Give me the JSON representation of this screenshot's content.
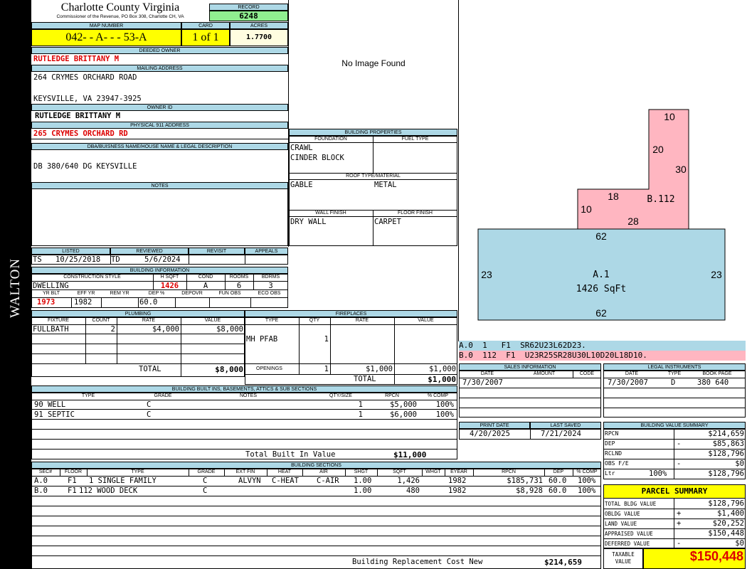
{
  "sidebar": {
    "district": "WALTON"
  },
  "header": {
    "county": "Charlotte County Virginia",
    "commissioner": "Commissioner of the Revenue, PO Box 308, Charlotte CH, VA",
    "record_label": "RECORD",
    "record": "6248",
    "map_number_label": "MAP NUMBER",
    "map_number": "042- - A- - - 53-A",
    "card_label": "CARD",
    "card": "1 of 1",
    "acres_label": "ACRES",
    "acres": "1.7700"
  },
  "owner": {
    "deeded_owner_label": "DEEDED OWNER",
    "deeded_owner": "RUTLEDGE BRITTANY M",
    "mailing_address_label": "MAILING ADDRESS",
    "address_line1": "264 CRYMES ORCHARD ROAD",
    "address_line2": "KEYSVILLE, VA 23947-3925",
    "owner_id_label": "OWNER ID",
    "owner_id": "RUTLEDGE BRITTANY M",
    "physical_address_label": "PHYSICAL 911 ADDRESS",
    "physical_address": "265 CRYMES ORCHARD RD",
    "dba_label": "DBA/BUISNESS NAME/HOUSE NAME & LEGAL DESCRIPTION",
    "legal_description": "DB 380/640 DG KEYSVILLE",
    "notes_label": "NOTES"
  },
  "image": {
    "placeholder": "No Image Found"
  },
  "building_properties": {
    "title": "BUILDING PROPERTIES",
    "foundation_label": "FOUNDATION",
    "fuel_type_label": "FUEL TYPE",
    "foundation1": "CRAWL",
    "foundation2": "CINDER BLOCK",
    "roof_label": "ROOF TYPE/MATERIAL",
    "roof_type": "GABLE",
    "roof_material": "METAL",
    "wall_finish_label": "WALL FINISH",
    "floor_finish_label": "FLOOR FINISH",
    "wall_finish": "DRY WALL",
    "floor_finish": "CARPET"
  },
  "review": {
    "listed_label": "LISTED",
    "reviewed_label": "REVIEWED",
    "revisit_label": "REVISIT",
    "appeals_label": "APPEALS",
    "listed_by": "TS",
    "listed_date": "10/25/2018",
    "reviewed_by": "TD",
    "reviewed_date": "5/6/2024"
  },
  "building_info": {
    "title": "BUILDING INFORMATION",
    "construction_style_label": "CONSTRUCTION STYLE",
    "hsqft_label": "H SQFT",
    "cond_label": "COND",
    "rooms_label": "ROOMS",
    "bdrms_label": "BDRMS",
    "construction_style": "DWELLING",
    "hsqft": "1426",
    "cond": "A",
    "rooms": "6",
    "bdrms": "3",
    "yr_blt_label": "YR BLT",
    "eff_yr_label": "EFF YR",
    "rem_yr_label": "REM YR",
    "dep_label": "DEP %",
    "depovr_label": "DEPOVR",
    "fun_obs_label": "FUN OBS",
    "eco_obs_label": "ECO OBS",
    "yr_blt": "1973",
    "eff_yr": "1982",
    "dep": "60.0"
  },
  "plumbing": {
    "title": "PLUMBING",
    "fixture_label": "FIXTURE",
    "count_label": "COUNT",
    "rate_label": "RATE",
    "value_label": "VALUE",
    "fixture": "FULLBATH",
    "count": "2",
    "rate": "$4,000",
    "value": "$8,000",
    "total_label": "TOTAL",
    "total": "$8,000"
  },
  "fireplaces": {
    "title": "FIREPLACES",
    "type_label": "TYPE",
    "qty_label": "QTY",
    "rate_label": "RATE",
    "value_label": "VALUE",
    "type": "MH PFAB",
    "qty": "1",
    "openings_label": "OPENINGS",
    "openings": "1",
    "openings_rate": "$1,000",
    "openings_value": "$1,000",
    "total_label": "TOTAL",
    "total": "$1,000"
  },
  "sketch": {
    "a_label": "A.1",
    "a_sqft": "1426 SqFt",
    "a_top": "62",
    "a_bottom": "62",
    "a_left": "23",
    "a_right": "23",
    "b_label": "B.112",
    "b_10_top": "10",
    "b_20": "20",
    "b_30": "30",
    "b_18": "18",
    "b_10_left": "10",
    "b_28": "28",
    "fill_a": "#add8e6",
    "fill_b": "#ffb6c1"
  },
  "traverse": {
    "a_line": "A.0  1   F1  SR62U23L62D23.",
    "b_line": "B.0  112  F1  U23R25SR28U30L10D20L18D10."
  },
  "sales": {
    "title": "SALES INFORMATION",
    "date_label": "DATE",
    "amount_label": "AMOUNT",
    "code_label": "CODE",
    "date": "7/30/2007"
  },
  "legal": {
    "title": "LEGAL INSTRUMENTS",
    "date_label": "DATE",
    "type_label": "TYPE",
    "bookpage_label": "BOOK PAGE",
    "date": "7/30/2007",
    "type": "D",
    "bookpage": "380 640"
  },
  "builtins": {
    "title": "BUILDING BUILT INS, BASEMENTS, ATTICS & SUB SECTIONS",
    "type_label": "TYPE",
    "grade_label": "GRADE",
    "notes_label": "NOTES",
    "qty_label": "QTY/SIZE",
    "rpcn_label": "RPCN",
    "comp_label": "% COMP",
    "rows": [
      {
        "type": "90 WELL",
        "grade": "C",
        "qty": "1",
        "rpcn": "$5,000",
        "comp": "100%"
      },
      {
        "type": "91 SEPTIC",
        "grade": "C",
        "qty": "1",
        "rpcn": "$6,000",
        "comp": "100%"
      }
    ],
    "total_label": "Total Built In Value",
    "total": "$11,000"
  },
  "dates": {
    "print_label": "PRINT DATE",
    "saved_label": "LAST SAVED",
    "print_date": "4/20/2025",
    "saved_date": "7/21/2024"
  },
  "value_summary": {
    "title": "BUILDING VALUE SUMMARY",
    "rpcn_label": "RPCN",
    "rpcn": "$214,659",
    "dep_label": "DEP",
    "dep_sign": "-",
    "dep": "$85,863",
    "rclnd_label": "RCLND",
    "rclnd": "$128,796",
    "obs_label": "OBS F/E",
    "obs_sign": "-",
    "obs": "$0",
    "ltr_label": "Ltr",
    "ltr_pct": "100%",
    "ltr": "$128,796"
  },
  "sections": {
    "title": "BUILDING SECTIONS",
    "headers": [
      "SEC#",
      "FLOOR",
      "TYPE",
      "GRADE",
      "EXT FIN",
      "HEAT",
      "AIR",
      "SHGT",
      "SQFT",
      "WHGT",
      "EYEAR",
      "RPCN",
      "DEP",
      "% COMP"
    ],
    "rows": [
      {
        "sec": "A.0",
        "floor": "F1",
        "type": "1 SINGLE FAMILY",
        "grade": "C",
        "ext": "ALVYN",
        "heat": "C-HEAT",
        "air": "C-AIR",
        "shgt": "1.00",
        "sqft": "1,426",
        "whgt": "",
        "eyear": "1982",
        "rpcn": "$185,731",
        "dep": "60.0",
        "comp": "100%"
      },
      {
        "sec": "B.0",
        "floor": "F1",
        "type": "112 WOOD DECK",
        "grade": "C",
        "ext": "",
        "heat": "",
        "air": "",
        "shgt": "1.00",
        "sqft": "480",
        "whgt": "",
        "eyear": "1982",
        "rpcn": "$8,928",
        "dep": "60.0",
        "comp": "100%"
      }
    ],
    "replacement_label": "Building Replacement Cost New",
    "replacement": "$214,659"
  },
  "parcel_summary": {
    "title": "PARCEL SUMMARY",
    "total_bldg_label": "TOTAL BLDG VALUE",
    "total_bldg": "$128,796",
    "obldg_label": "OBLDG VALUE",
    "obldg_sign": "+",
    "obldg": "$1,400",
    "land_label": "LAND VALUE",
    "land_sign": "+",
    "land": "$20,252",
    "appraised_label": "APPRAISED VALUE",
    "appraised": "$150,448",
    "deferred_label": "DEFERRED VALUE",
    "deferred_sign": "-",
    "deferred": "$0",
    "taxable_label1": "TAXABLE",
    "taxable_label2": "VALUE",
    "taxable": "$150,448",
    "accent_yellow": "#ffff00",
    "accent_green": "#90ee90",
    "accent_red": "#dd0000"
  }
}
